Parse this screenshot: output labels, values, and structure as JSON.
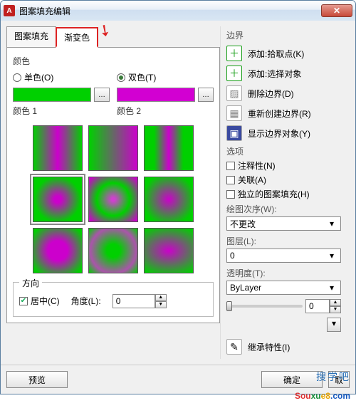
{
  "window": {
    "title": "图案填充编辑"
  },
  "tabs": {
    "pattern": "图案填充",
    "gradient": "渐变色"
  },
  "color": {
    "group": "颜色",
    "single": "单色(O)",
    "double": "双色(T)",
    "label1": "颜色 1",
    "label2": "颜色 2"
  },
  "direction": {
    "group": "方向",
    "center": "居中(C)",
    "angle": "角度(L):",
    "angle_value": "0"
  },
  "boundary": {
    "title": "边界",
    "add_pick": "添加:拾取点(K)",
    "add_select": "添加:选择对象",
    "remove": "删除边界(D)",
    "recreate": "重新创建边界(R)",
    "show": "显示边界对象(Y)"
  },
  "options": {
    "title": "选项",
    "annotative": "注释性(N)",
    "associative": "关联(A)",
    "independent": "独立的图案填充(H)"
  },
  "draworder": {
    "label": "绘图次序(W):",
    "value": "不更改"
  },
  "layer": {
    "label": "图层(L):",
    "value": "0"
  },
  "transparency": {
    "label": "透明度(T):",
    "value": "ByLayer",
    "slider": "0"
  },
  "inherit": "继承特性(I)",
  "footer": {
    "preview": "预览",
    "ok": "确定",
    "cancel": "取"
  },
  "watermark": {
    "cn": "搜学吧",
    "en": "Souxue8.com"
  }
}
